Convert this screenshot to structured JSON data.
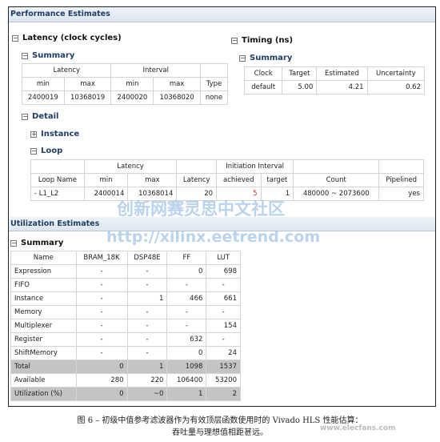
{
  "perf": {
    "title": "Performance Estimates",
    "latency": {
      "title": "Latency (clock cycles)",
      "summary": "Summary",
      "groups": [
        "Latency",
        "Interval"
      ],
      "headers": [
        "min",
        "max",
        "min",
        "max",
        "Type"
      ],
      "row": [
        "2400019",
        "10368019",
        "2400020",
        "10368020",
        "none"
      ]
    },
    "timing": {
      "title": "Timing (ns)",
      "summary": "Summary",
      "headers": [
        "Clock",
        "Target",
        "Estimated",
        "Uncertainty"
      ],
      "row": [
        "default",
        "5.00",
        "4.21",
        "0.62"
      ]
    },
    "detail": {
      "title": "Detail",
      "instance": "Instance",
      "loop": "Loop",
      "groups": [
        "Latency",
        "Initiation Interval"
      ],
      "headers": [
        "Loop Name",
        "min",
        "max",
        "Latency",
        "achieved",
        "target",
        "Count",
        "Pipelined"
      ],
      "row": [
        "- L1_L2",
        "2400014",
        "10368014",
        "20",
        "5",
        "1",
        "480000 ~ 2073600",
        "yes"
      ],
      "achieved_color": "#d03030"
    }
  },
  "util": {
    "title": "Utilization Estimates",
    "summary": "Summary",
    "headers": [
      "Name",
      "BRAM_18K",
      "DSP48E",
      "FF",
      "LUT"
    ],
    "rows": [
      [
        "Expression",
        "-",
        "-",
        "0",
        "698"
      ],
      [
        "FIFO",
        "-",
        "-",
        "-",
        "-"
      ],
      [
        "Instance",
        "-",
        "1",
        "466",
        "661"
      ],
      [
        "Memory",
        "-",
        "-",
        "-",
        "-"
      ],
      [
        "Multiplexer",
        "-",
        "-",
        "-",
        "154"
      ],
      [
        "Register",
        "-",
        "-",
        "632",
        "-"
      ],
      [
        "ShiftMemory",
        "-",
        "-",
        "0",
        "24"
      ],
      [
        "Total",
        "0",
        "1",
        "1098",
        "1537"
      ],
      [
        "Available",
        "280",
        "220",
        "106400",
        "53200"
      ],
      [
        "Utilization (%)",
        "0",
        "~0",
        "1",
        "2"
      ]
    ]
  },
  "watermarks": [
    "创新网赛灵思中文社区",
    "http://xilinx.eetrend.com",
    "www.elecfans.com"
  ],
  "caption": {
    "line1": "图 6 – 初级中值参考滤波器作为有效顶层函数使用时的 Vivado HLS 性能估算：",
    "line2": "吞吐量与理想值相距甚远。"
  }
}
